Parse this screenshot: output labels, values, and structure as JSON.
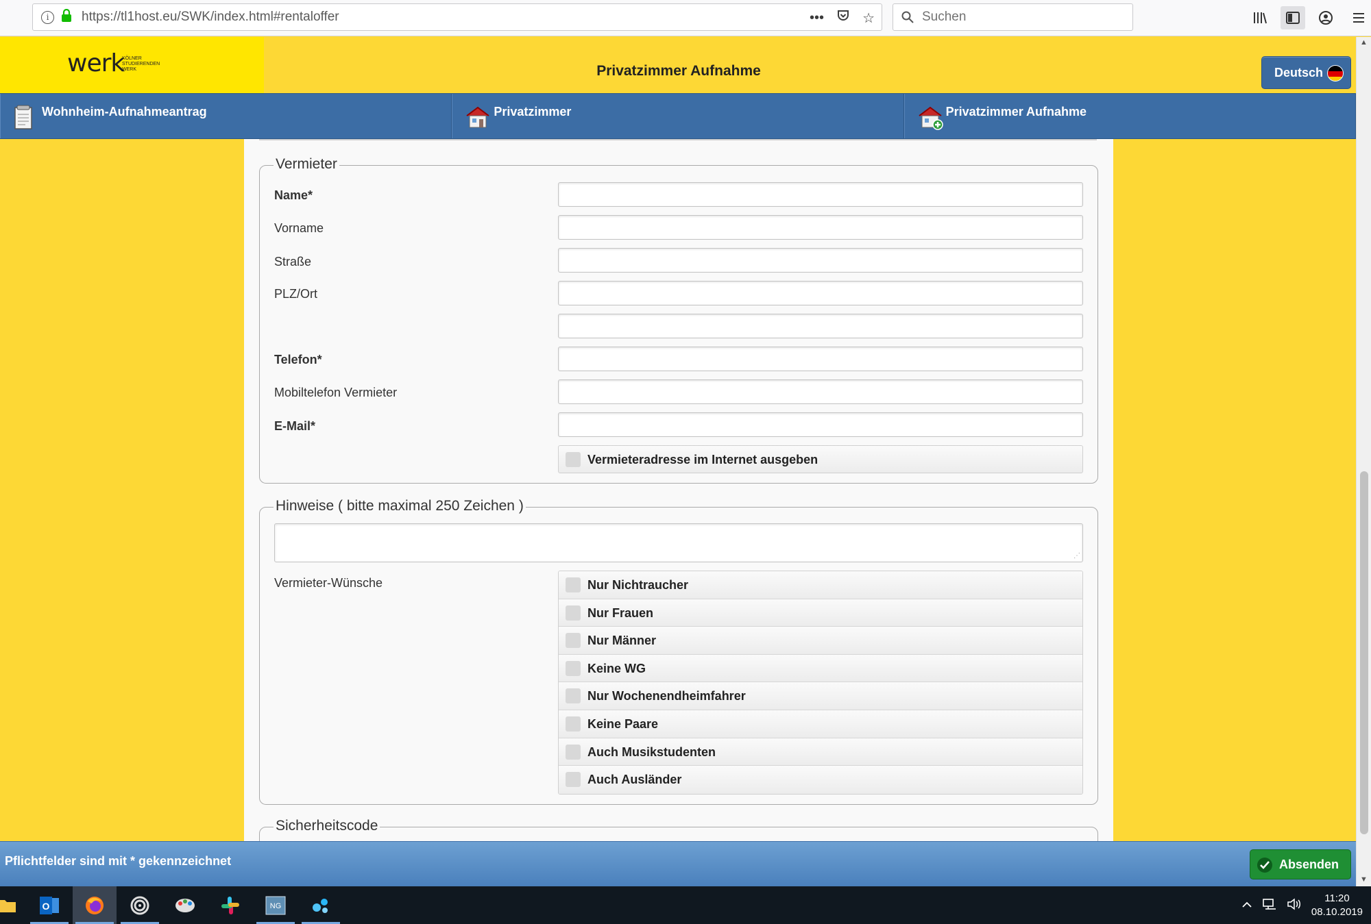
{
  "browser": {
    "url": "https://tl1host.eu/SWK/index.html#rentaloffer",
    "search_placeholder": "Suchen"
  },
  "header": {
    "logo_text": "werk",
    "logo_sub": "KÖLNER STUDIERENDEN WERK",
    "title": "Privatzimmer Aufnahme",
    "language_button": "Deutsch"
  },
  "nav": {
    "items": [
      {
        "label": "Wohnheim-Aufnahmeantrag",
        "icon": "document-icon"
      },
      {
        "label": "Privatzimmer",
        "icon": "house-icon"
      },
      {
        "label": "Privatzimmer Aufnahme",
        "icon": "house-add-icon"
      }
    ]
  },
  "landlord": {
    "legend": "Vermieter",
    "fields": [
      {
        "label": "Name*",
        "value": "",
        "required": true
      },
      {
        "label": "Vorname",
        "value": "",
        "required": false
      },
      {
        "label": "Straße",
        "value": "",
        "required": false
      },
      {
        "label": "PLZ/Ort",
        "value": "",
        "required": false
      },
      {
        "label": "",
        "value": "",
        "required": false
      },
      {
        "label": "Telefon*",
        "value": "",
        "required": true
      },
      {
        "label": "Mobiltelefon Vermieter",
        "value": "",
        "required": false
      },
      {
        "label": "E-Mail*",
        "value": "",
        "required": true
      }
    ],
    "publish_checkbox": {
      "label": "Vermieteradresse im Internet ausgeben",
      "checked": false
    }
  },
  "notes": {
    "legend": "Hinweise ( bitte maximal 250 Zeichen )",
    "value": "",
    "wishes_label": "Vermieter-Wünsche",
    "wishes": [
      {
        "label": "Nur Nichtraucher",
        "checked": false
      },
      {
        "label": "Nur Frauen",
        "checked": false
      },
      {
        "label": "Nur Männer",
        "checked": false
      },
      {
        "label": "Keine WG",
        "checked": false
      },
      {
        "label": "Nur Wochenendheimfahrer",
        "checked": false
      },
      {
        "label": "Keine Paare",
        "checked": false
      },
      {
        "label": "Auch Musikstudenten",
        "checked": false
      },
      {
        "label": "Auch Ausländer",
        "checked": false
      }
    ]
  },
  "security": {
    "legend": "Sicherheitscode"
  },
  "footer": {
    "note": "Pflichtfelder sind mit * gekennzeichnet",
    "submit_label": "Absenden"
  },
  "taskbar": {
    "time": "11:20",
    "date": "08.10.2019"
  },
  "colors": {
    "page_bg": "#fdd835",
    "nav_blue": "#3c6da5",
    "submit_green": "#1f8f34"
  }
}
